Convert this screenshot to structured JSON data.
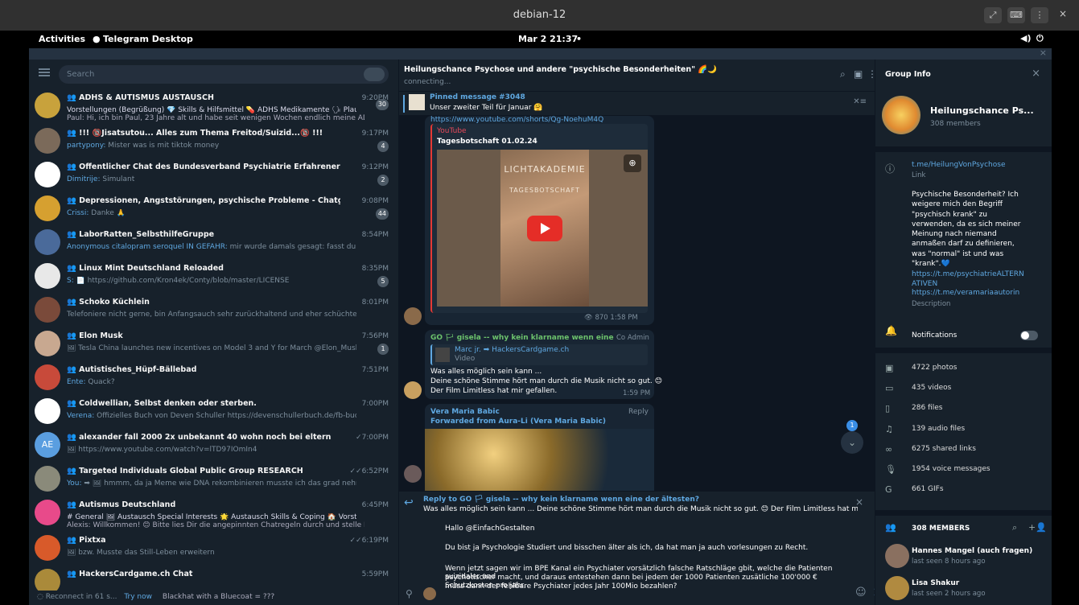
{
  "vm": {
    "title": "debian-12"
  },
  "topbar": {
    "activities": "Activities",
    "app": "Telegram Desktop",
    "datetime": "Mar 2  21:37"
  },
  "left": {
    "search_placeholder": "Search",
    "chats": [
      {
        "name": "ADHS & AUTISMUS AUSTAUSCH",
        "time": "9:20PM",
        "preview": "Vorstellungen (Begrüßung)  💎 Skills & Hilfsmittel  💊 ADHS Medikamente  🗣 Plaudere...",
        "preview2": "Paul: Hi, ich bin Paul, 23 Jahre alt und habe seit wenigen Wochen endlich meine ADHS Diagn...",
        "badge": "30",
        "color": "#c8a23c"
      },
      {
        "name": "!!! 🔞Jisatsutou... Alles zum Thema Freitod/Suizid...🔞 !!!",
        "time": "9:17PM",
        "sender": "partypony:",
        "preview": " Mister was is mit tiktok money",
        "badge": "4",
        "color": "#7b6a5a"
      },
      {
        "name": "Öffentlicher Chat des Bundesverband Psychiatrie Erfahrener / BPE_e.V.",
        "time": "9:12PM",
        "sender": "Dimitrije:",
        "preview": " Simulant",
        "badge": "2",
        "color": "#ffffff"
      },
      {
        "name": "Depressionen, Angststörungen, psychische Probleme - Chatgruppe",
        "time": "9:08PM",
        "sender": "Crissi:",
        "preview": " Danke 🙏",
        "badge": "44",
        "color": "#d6a030"
      },
      {
        "name": "LaborRatten_SelbsthilfeGruppe",
        "time": "8:54PM",
        "sender": "Anonymous citalopram seroquel IN GEFAHR:",
        "preview": " mir wurde damals gesagt: fasst du brenessel an: ist g...",
        "badge": "",
        "color": "#4a6a9a"
      },
      {
        "name": "Linux Mint Deutschland Reloaded",
        "time": "8:35PM",
        "sender": "S:",
        "preview": " 📄 https://github.com/Kron4ek/Conty/blob/master/LICENSE",
        "badge": "5",
        "color": "#e8e8e8"
      },
      {
        "name": "Schoko Küchlein",
        "time": "8:01PM",
        "sender": "",
        "preview": "Telefoniere nicht gerne, bin Anfangsauch sehr zurückhaltend und eher schüchtern, deswegen wäre...",
        "badge": "",
        "color": "#7a4a3a"
      },
      {
        "name": "Elon Musk",
        "time": "7:56PM",
        "sender": "",
        "preview": "🖼 Tesla China launches new incentives on Model 3 and Y for March  @Elon_Musk",
        "badge": "1",
        "color": "#c8a890"
      },
      {
        "name": "Autistisches_Hüpf-Bällebad",
        "time": "7:51PM",
        "sender": "Ente:",
        "preview": " Quack?",
        "badge": "",
        "color": "#c84a3a"
      },
      {
        "name": "Coldwellian, Selbst denken oder sterben.",
        "time": "7:00PM",
        "sender": "Verena:",
        "preview": " Offizielles Buch von Deven Schuller https://devenschullerbuch.de/fb-buch/?utm_campaign...",
        "badge": "",
        "color": "#ffffff"
      },
      {
        "name": "alexander fall 2000 2x unbekannt 40 wohn noch bei eltern",
        "time": "✓7:00PM",
        "sender": "",
        "preview": "🖼 https://www.youtube.com/watch?v=lTD97IOmIn4",
        "badge": "",
        "color": "#5a9ee0",
        "initials": "AE"
      },
      {
        "name": "Targeted Individuals Global Public Group RESEARCH",
        "time": "✓✓6:52PM",
        "sender": "You:",
        "preview": " ➡ 🖼 hmmm, da ja Meme wie DNA rekombinieren musste ich das grad nehmen und dran ru...",
        "badge": "",
        "color": "#8a8a7a"
      },
      {
        "name": "Autismus Deutschland",
        "time": "6:45PM",
        "sender": "",
        "preview": "# General  🖼 Austausch Special Interests  🌟 Austausch Skills & Coping  🏠 Vorstellungsrunde ...",
        "preview2": "Alexis: Willkommen! 😊 Bitte lies Dir die angepinnten Chatregeln durch und stelle Dich kurz vor.",
        "badge": "",
        "color": "#e84a8a"
      },
      {
        "name": "Pixtxa",
        "time": "✓✓6:19PM",
        "sender": "",
        "preview": "🖼 bzw. Musste das Still-Leben erweitern",
        "badge": "",
        "color": "#d85a2a"
      },
      {
        "name": "HackersCardgame.ch Chat",
        "time": "5:59PM",
        "sender": "",
        "preview": "",
        "badge": "",
        "color": "#aa8a3a"
      }
    ],
    "footer": {
      "reconnect": "Reconnect in 61 s...",
      "try_now": "Try now",
      "status": "Blackhat with a Bluecoat = ???"
    }
  },
  "middle": {
    "title": "Heilungschance Psychose und andere \"psychische Besonderheiten\" 🌈🌙",
    "status": "connecting...",
    "pinned_label": "Pinned message #3048",
    "pinned_text": "Unser zweiter Teil für Januar 🤗",
    "yt_link": "https://www.youtube.com/shorts/Qg-NoehuM4Q",
    "yt_site": "YouTube",
    "yt_title": "Tagesbotschaft 01.02.24",
    "video_caption_top": "LICHTAKADEMIE",
    "video_caption_mid": "TAGESBOTSCHAFT",
    "views": "👁 870  1:58 PM",
    "msg2_sender": "GO 🏳 gisela -- why kein klarname wenn eine der äl...",
    "msg2_role": "Co Admin",
    "msg2_quote_name": "Marc jr. ➡ HackersCardgame.ch",
    "msg2_quote_type": "Video",
    "msg2_l1": "Was alles möglich sein kann ...",
    "msg2_l2": "Deine schöne Stimme hört man durch die Musik nicht so gut. 😊",
    "msg2_l3": "Der Film Limitless hat mir gefallen.",
    "msg2_time": "1:59 PM",
    "msg3_sender": "Vera Maria Babic",
    "msg3_fwd": "Forwarded from Aura-Li (Vera Maria Babic)",
    "msg3_reply": "Reply",
    "unread": "1",
    "reply_to": "Reply to GO 🏳 gisela -- why kein klarname wenn eine der ältesten?",
    "reply_quote": "Was alles möglich sein kann ... Deine schöne Stimme hört man durch die Musik nicht so gut. 😊 Der Film Limitless hat mir gefallen.",
    "draft1": "Hallo @EinfachGestalten",
    "draft2": "Du bist ja Psychologie Studiert und bisschen älter als ich, da hat man ja auch vorlesungen zu Recht.",
    "draft3": "Wenn jetzt sagen wir im BPE Kanal ein Psychiater vorsätzlich falsche Ratschläge gbit, welche die Patienten suizidaler und",
    "draft4": "psychotischer macht, und daraus entestehen dann bei jedem der 1000 Patienten zusätliche 100'000 € Schutzkosten pro jahr,",
    "draft5": "muss dann der fehlbare Psychiater jedes Jahr 100Mio bezahlen?"
  },
  "right": {
    "header": "Group Info",
    "group_name": "Heilungschance Ps...",
    "members": "308 members",
    "link": "t.me/HeilungVonPsychose",
    "link_label": "Link",
    "desc": "Psychische Besonderheit? Ich weigere mich den Begriff \"psychisch krank\" zu verwenden, da es sich meiner Meinung nach niemand anmaßen darf zu definieren, was \"normal\" ist und was \"krank\".💙",
    "desc_link1": "https://t.me/psychiatrieALTERNATIVEN",
    "desc_link2": "https://t.me/veramariaautorin",
    "desc_label": "Description",
    "notifications": "Notifications",
    "stats": [
      {
        "icon": "photo-icon",
        "glyph": "▣",
        "label": "4722 photos"
      },
      {
        "icon": "video-icon",
        "glyph": "▭",
        "label": "435 videos"
      },
      {
        "icon": "file-icon",
        "glyph": "▯",
        "label": "286 files"
      },
      {
        "icon": "headphones-icon",
        "glyph": "♫",
        "label": "139 audio files"
      },
      {
        "icon": "link-icon",
        "glyph": "∞",
        "label": "6275 shared links"
      },
      {
        "icon": "mic-icon",
        "glyph": "🎙",
        "label": "1954 voice messages"
      },
      {
        "icon": "gif-icon",
        "glyph": "G",
        "label": "661 GIFs"
      }
    ],
    "members_header": "308 MEMBERS",
    "member_list": [
      {
        "name": "Hannes Mangel (auch fragen)",
        "seen": "last seen 8 hours ago",
        "color": "#8a7060"
      },
      {
        "name": "Lisa Shakur",
        "seen": "last seen 2 hours ago",
        "color": "#b08a40"
      }
    ]
  }
}
